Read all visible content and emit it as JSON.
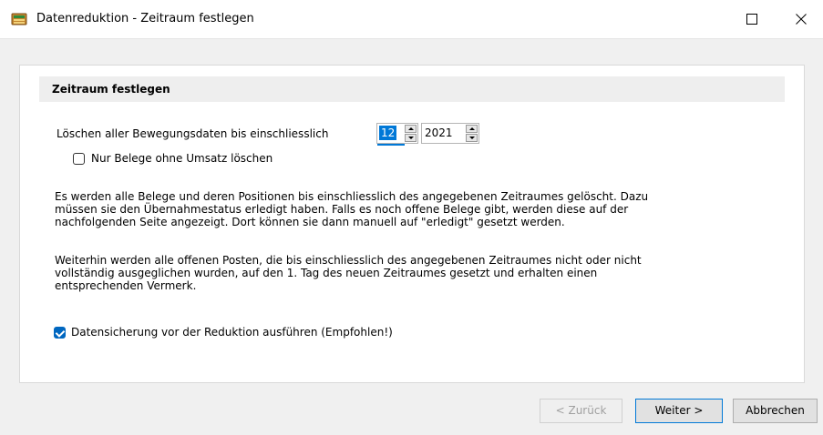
{
  "window": {
    "title": "Datenreduktion - Zeitraum festlegen",
    "icon": "database-app-icon"
  },
  "section": {
    "title": "Zeitraum festlegen"
  },
  "period": {
    "label": "Löschen aller Bewegungsdaten bis einschliesslich",
    "month": "12",
    "year": "2021"
  },
  "options": {
    "only_no_revenue": {
      "label": "Nur Belege ohne Umsatz löschen",
      "checked": false
    },
    "backup": {
      "label": "Datensicherung vor der Reduktion ausführen (Empfohlen!)",
      "checked": true
    }
  },
  "info": {
    "line1": "Es werden alle Belege und deren Positionen bis einschliesslich des angegebenen Zeitraumes gelöscht. Dazu",
    "line2": "müssen sie den Übernahmestatus erledigt haben. Falls es noch offene Belege gibt, werden diese auf der",
    "line3": "nachfolgenden Seite angezeigt. Dort können sie dann manuell auf \"erledigt\" gesetzt werden.",
    "line4": "Weiterhin werden alle offenen Posten, die bis einschliesslich des angegebenen Zeitraumes nicht oder nicht",
    "line5": "vollständig ausgeglichen wurden, auf den 1. Tag des neuen Zeitraumes gesetzt und erhalten einen",
    "line6": "entsprechenden Vermerk."
  },
  "buttons": {
    "back": "< Zurück",
    "next": "Weiter >",
    "cancel": "Abbrechen"
  },
  "colors": {
    "accent": "#0078d7",
    "checkbox_checked": "#0067c0"
  }
}
